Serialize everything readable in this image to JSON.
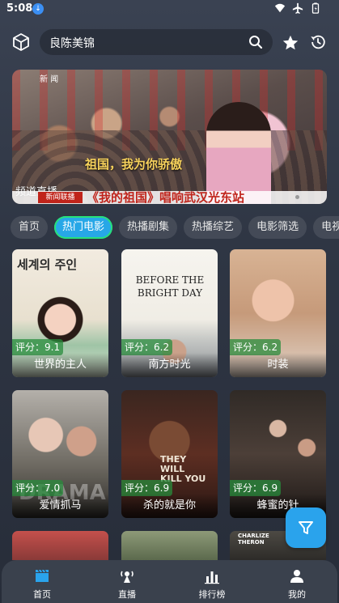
{
  "status_bar": {
    "time": "5:08"
  },
  "header": {
    "search_text": "良陈美锦"
  },
  "banner": {
    "caption": "祖国，我为你骄傲",
    "channel_label": "频道直播",
    "ticker_text": "《我的祖国》唱响武汉光东站",
    "ticker_tag": "新闻联播",
    "logo_text": "新 闻"
  },
  "tabs": [
    "首页",
    "热门电影",
    "热播剧集",
    "热播综艺",
    "电影筛选",
    "电视"
  ],
  "active_tab": "热门电影",
  "movies": [
    {
      "title": "世界的主人",
      "rating_label": "评分：9.1",
      "poster_text": "세계의 주인"
    },
    {
      "title": "南方时光",
      "rating_label": "评分：6.2",
      "poster_text": "BEFORE THE BRIGHT DAY"
    },
    {
      "title": "时装",
      "rating_label": "评分：6.2",
      "poster_text": ""
    },
    {
      "title": "爱情抓马",
      "rating_label": "评分：7.0",
      "poster_text": "DRAMA"
    },
    {
      "title": "杀的就是你",
      "rating_label": "评分：6.9",
      "poster_text": "THEY WILL KILL YOU"
    },
    {
      "title": "蜂蜜的针",
      "rating_label": "评分：6.9",
      "poster_text": ""
    },
    {
      "title": "",
      "rating_label": "",
      "poster_text": ""
    },
    {
      "title": "",
      "rating_label": "",
      "poster_text": ""
    },
    {
      "title": "",
      "rating_label": "",
      "poster_text": "CHARLIZE THERON"
    }
  ],
  "bottom_nav": [
    {
      "label": "首页",
      "icon": "clapperboard-icon"
    },
    {
      "label": "直播",
      "icon": "live-icon"
    },
    {
      "label": "排行榜",
      "icon": "bar-chart-icon"
    },
    {
      "label": "我的",
      "icon": "person-icon"
    }
  ],
  "colors": {
    "accent": "#2aa3ec",
    "tab_active": "#27a7e7",
    "nav_bg": "#3a414d"
  }
}
